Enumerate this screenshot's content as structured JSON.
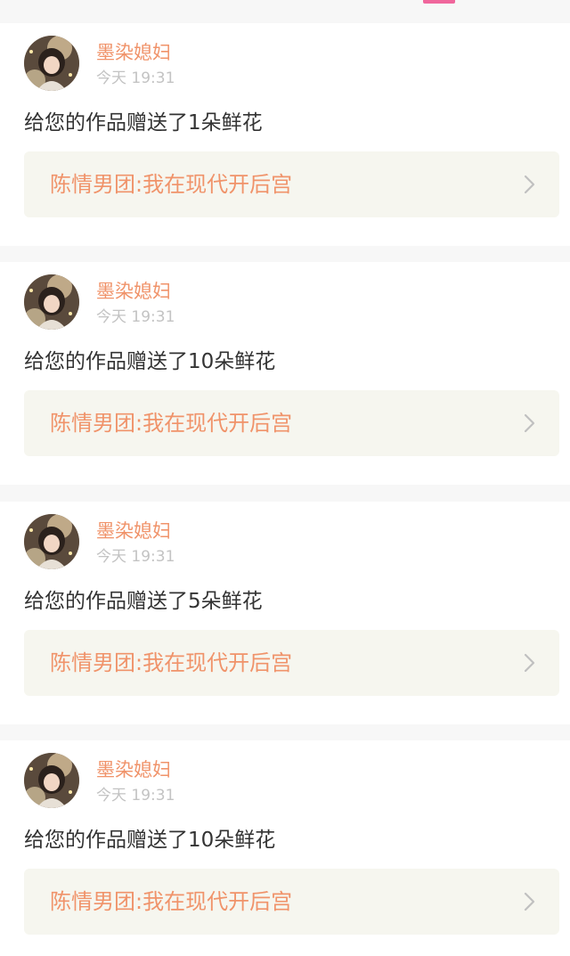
{
  "notifications": [
    {
      "user_name": "墨染媳妇",
      "time": "今天 19:31",
      "message": "给您的作品赠送了1朵鲜花",
      "work_title": "陈情男团:我在现代开后宫"
    },
    {
      "user_name": "墨染媳妇",
      "time": "今天 19:31",
      "message": "给您的作品赠送了10朵鲜花",
      "work_title": "陈情男团:我在现代开后宫"
    },
    {
      "user_name": "墨染媳妇",
      "time": "今天 19:31",
      "message": "给您的作品赠送了5朵鲜花",
      "work_title": "陈情男团:我在现代开后宫"
    },
    {
      "user_name": "墨染媳妇",
      "time": "今天 19:31",
      "message": "给您的作品赠送了10朵鲜花",
      "work_title": "陈情男团:我在现代开后宫"
    }
  ],
  "colors": {
    "accent_pink": "#f0669c",
    "name_orange": "#f0936a",
    "time_gray": "#c3c3c3",
    "message_dark": "#333333",
    "link_bg": "#f6f6ef",
    "page_bg": "#f7f7f7"
  },
  "icons": {
    "avatar": "user-avatar-photo",
    "chevron": "chevron-right-icon"
  }
}
